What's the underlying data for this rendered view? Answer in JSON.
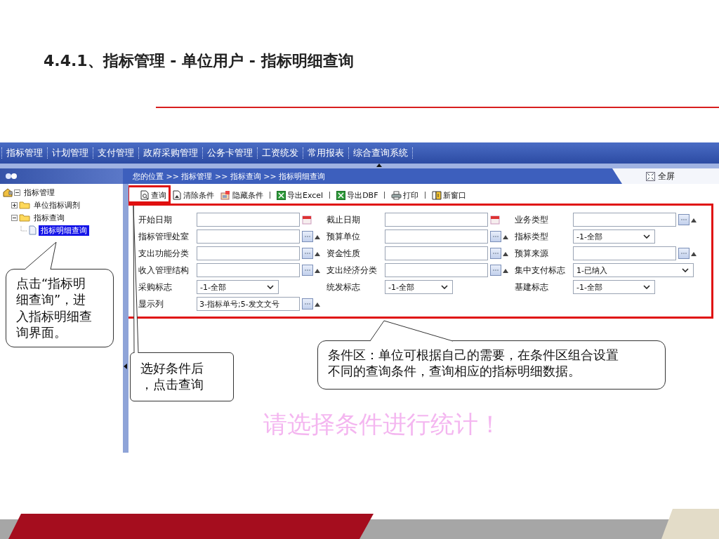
{
  "slide_title": "4.4.1、指标管理 - 单位用户 - 指标明细查询",
  "nav_menu": [
    "指标管理",
    "计划管理",
    "支付管理",
    "政府采购管理",
    "公务卡管理",
    "工资统发",
    "常用报表",
    "综合查询系统"
  ],
  "breadcrumb": "您的位置 >> 指标管理 >> 指标查询 >> 指标明细查询",
  "fullscreen": "全屏",
  "tree": [
    {
      "label": "指标管理",
      "kind": "home",
      "expanded": true,
      "selected": false,
      "children": [
        {
          "label": "单位指标调剂",
          "kind": "folder",
          "expanded": false,
          "selected": false
        },
        {
          "label": "指标查询",
          "kind": "folder",
          "expanded": true,
          "selected": false,
          "children": [
            {
              "label": "指标明细查询",
              "kind": "page",
              "selected": true
            }
          ]
        }
      ]
    }
  ],
  "toolbar": [
    {
      "label": "查询",
      "kind": "search",
      "separator_before": false,
      "highlighted": true
    },
    {
      "label": "清除条件",
      "kind": "clear",
      "separator_before": false,
      "highlighted": false
    },
    {
      "label": "隐藏条件",
      "kind": "hide",
      "separator_before": false,
      "highlighted": false
    },
    {
      "label": "导出Excel",
      "kind": "excel",
      "separator_before": true,
      "highlighted": false
    },
    {
      "label": "导出DBF",
      "kind": "excel",
      "separator_before": true,
      "highlighted": false
    },
    {
      "label": "打印",
      "kind": "print",
      "separator_before": true,
      "highlighted": false
    },
    {
      "label": "新窗口",
      "kind": "window",
      "separator_before": true,
      "highlighted": false
    }
  ],
  "conditions": [
    [
      {
        "label": "开始日期",
        "kind": "date"
      },
      {
        "label": "截止日期",
        "kind": "date"
      },
      {
        "label": "业务类型",
        "kind": "lookup"
      }
    ],
    [
      {
        "label": "指标管理处室",
        "kind": "lookup"
      },
      {
        "label": "预算单位",
        "kind": "lookup"
      },
      {
        "label": "指标类型",
        "kind": "select",
        "value": "-1-全部"
      }
    ],
    [
      {
        "label": "支出功能分类",
        "kind": "lookup"
      },
      {
        "label": "资金性质",
        "kind": "lookup"
      },
      {
        "label": "预算来源",
        "kind": "lookup"
      }
    ],
    [
      {
        "label": "收入管理结构",
        "kind": "lookup"
      },
      {
        "label": "支出经济分类",
        "kind": "lookup"
      },
      {
        "label": "集中支付标志",
        "kind": "select",
        "value": "1-已纳入"
      }
    ],
    [
      {
        "label": "采购标志",
        "kind": "select",
        "value": "-1-全部"
      },
      {
        "label": "统发标志",
        "kind": "select",
        "value": "-1-全部"
      },
      {
        "label": "基建标志",
        "kind": "select",
        "value": "-1-全部"
      }
    ],
    [
      {
        "label": "显示列",
        "kind": "lookup",
        "value": "3-指标单号;5-发文文号"
      }
    ]
  ],
  "prompt": "请选择条件进行统计！",
  "callouts": [
    "点击“指标明细查询”，进入指标明细查询界面。",
    "选好条件后，点击查询",
    "条件区：单位可根据自己的需要，在条件区组合设置不同的查询条件，查询相应的指标明细数据。"
  ]
}
